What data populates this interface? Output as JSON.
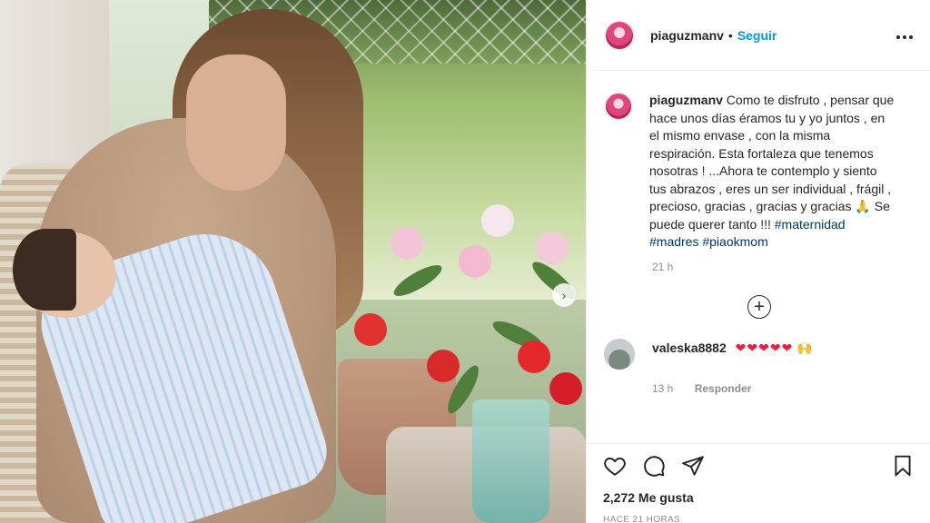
{
  "post": {
    "username": "piaguzmanv",
    "dot": "•",
    "follow_label": "Seguir",
    "more_label": "•••"
  },
  "caption": {
    "username": "piaguzmanv",
    "text": "Como te disfruto , pensar que hace unos días éramos tu y yo juntos , en el mismo envase , con la misma respiración. Esta fortaleza que tenemos nosotras ! ...Ahora te contemplo y siento tus abrazos , eres un ser individual , frágil , precioso, gracias , gracias y gracias 🙏 Se puede querer tanto !!! ",
    "hashtags": [
      "#maternidad",
      "#madres",
      "#piaokmom"
    ],
    "time": "21 h"
  },
  "load_more_symbol": "+",
  "comment": {
    "username": "valeska8882",
    "text": "❤❤❤❤❤",
    "emoji": "🙌",
    "time": "13 h",
    "reply_label": "Responder"
  },
  "actions": {
    "likes": "2,272 Me gusta",
    "posted": "HACE 21 HORAS"
  },
  "photo": {
    "next_symbol": "›"
  },
  "colors": {
    "follow": "#0095f6",
    "hashtag": "#00376b",
    "heart": "#ed1c3d",
    "muted": "#8e8e8e"
  }
}
